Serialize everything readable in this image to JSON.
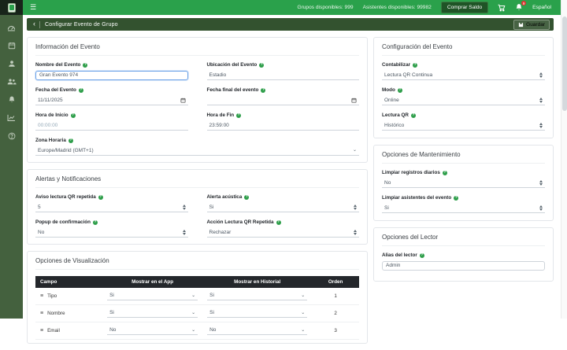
{
  "glyphs": {
    "hamburger": "☰",
    "back": "‹",
    "drag_handle": "≡",
    "chevron_down": "⌄"
  },
  "topbar": {
    "groups_available": "Grupos disponibles: 999",
    "attendees_available": "Asistentes disponibles: 99982",
    "buy_balance_label": "Comprar Saldo",
    "notification_badge": "9",
    "language_label": "Español"
  },
  "sidebar": {
    "items": [
      {
        "icon": "dashboard-icon"
      },
      {
        "icon": "calendar-icon"
      },
      {
        "icon": "user-icon"
      },
      {
        "icon": "users-icon"
      },
      {
        "icon": "bell-icon"
      },
      {
        "icon": "chart-icon"
      },
      {
        "icon": "help-icon"
      }
    ]
  },
  "header": {
    "title": "Configurar Evento de Grupo",
    "save_label": "Guardar"
  },
  "event_info": {
    "title": "Información del Evento",
    "name_label": "Nombre del Evento",
    "name_value": "Gran Evento 974",
    "location_label": "Ubicación del Evento",
    "location_value": "Estadio",
    "date_label": "Fecha del Evento",
    "date_value": "11/11/2025",
    "end_date_label": "Fecha final del evento",
    "end_date_value": "",
    "start_time_label": "Hora de Inicio",
    "start_time_value": "00:00:00",
    "end_time_label": "Hora de Fin",
    "end_time_value": "23:59:00",
    "timezone_label": "Zona Horaria",
    "timezone_value": "Europe/Madrid (GMT+1)"
  },
  "alerts": {
    "title": "Alertas y Notificaciones",
    "repeat_qr_label": "Aviso lectura QR repetida",
    "repeat_qr_value": "5",
    "acoustic_label": "Alerta acústica",
    "acoustic_value": "Si",
    "popup_label": "Popup de confirmación",
    "popup_value": "No",
    "repeat_action_label": "Acción Lectura QR Repetida",
    "repeat_action_value": "Rechazar"
  },
  "display_options": {
    "title": "Opciones de Visualización",
    "columns": [
      "Campo",
      "Mostrar en el App",
      "Mostrar en Historial",
      "Orden"
    ],
    "rows": [
      {
        "field": "Tipo",
        "app": "Si",
        "history": "Si",
        "order": "1"
      },
      {
        "field": "Nombre",
        "app": "Si",
        "history": "Si",
        "order": "2"
      },
      {
        "field": "Email",
        "app": "No",
        "history": "No",
        "order": "3"
      }
    ]
  },
  "event_config": {
    "title": "Configuración del Evento",
    "count_label": "Contabilizar",
    "count_value": "Lectura QR Continua",
    "mode_label": "Modo",
    "mode_value": "Online",
    "qr_reading_label": "Lectura QR",
    "qr_reading_value": "Histórico"
  },
  "maintenance": {
    "title": "Opciones de Mantenimiento",
    "clear_daily_label": "Limpiar registros diarios",
    "clear_daily_value": "No",
    "clear_attendees_label": "Limpiar asistentes del evento",
    "clear_attendees_value": "Si"
  },
  "reader": {
    "title": "Opciones del Lector",
    "alias_label": "Alias del lector",
    "alias_value": "Admin"
  },
  "colors": {
    "topbar": "#2aa14b",
    "sidebar": "#44613e",
    "header_strip": "#33522f",
    "accent": "#2e9e4a"
  }
}
